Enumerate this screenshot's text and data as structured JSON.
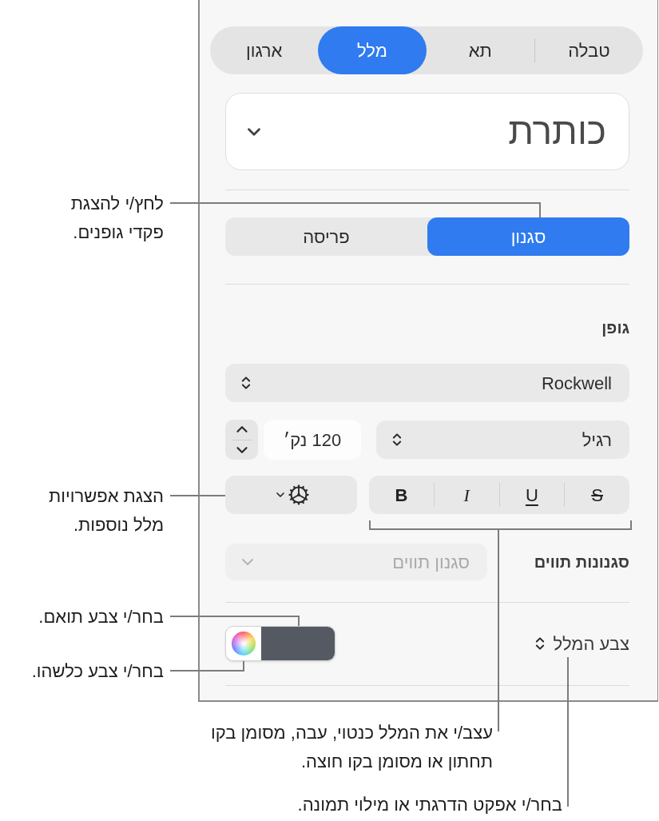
{
  "tabs": [
    {
      "label": "טבלה",
      "selected": false
    },
    {
      "label": "תא",
      "selected": false
    },
    {
      "label": "מלל",
      "selected": true
    },
    {
      "label": "ארגון",
      "selected": false
    }
  ],
  "paragraph_style": {
    "value": "כותרת"
  },
  "segments": [
    {
      "label": "סגנון",
      "selected": true
    },
    {
      "label": "פריסה",
      "selected": false
    }
  ],
  "font": {
    "heading": "גופן",
    "family": "Rockwell",
    "typeface": "רגיל",
    "size": "120 נק׳",
    "styles": [
      {
        "kind": "strikethrough",
        "label": "S",
        "on": false
      },
      {
        "kind": "underline",
        "label": "U",
        "on": false
      },
      {
        "kind": "italic",
        "label": "I",
        "on": false
      },
      {
        "kind": "bold",
        "label": "B",
        "on": false
      }
    ]
  },
  "character_styles": {
    "label": "סגנונות תווים",
    "placeholder": "סגנון תווים",
    "disabled": true
  },
  "text_color": {
    "label": "צבע המלל",
    "color": "#555a62"
  },
  "callouts": [
    {
      "lines": [
        "לחץ/י להצגת",
        "פקדי גופנים."
      ]
    },
    {
      "lines": [
        "הצגת אפשרויות",
        "מלל נוספות."
      ]
    },
    {
      "lines": [
        "בחר/י צבע תואם."
      ]
    },
    {
      "lines": [
        "בחר/י צבע כלשהו."
      ]
    },
    {
      "lines": [
        "עצב/י את המלל כנטוי, עבה, מסומן בקו",
        "תחתון או מסומן בקו חוצה."
      ]
    },
    {
      "lines": [
        "בחר/י אפקט הדרגתי או מילוי תמונה."
      ]
    }
  ]
}
